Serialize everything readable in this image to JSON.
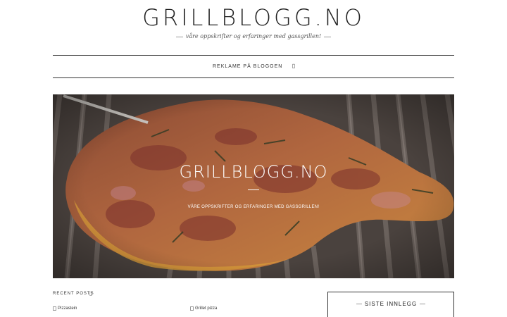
{
  "header": {
    "site_title": "GRILLBLOGG.NO",
    "tagline": "våre oppskrifter og erfaringer med gassgrillen!"
  },
  "nav": {
    "items": [
      {
        "label": "REKLAME PÅ BLOGGEN"
      }
    ],
    "search_icon": "search-icon"
  },
  "hero": {
    "title": "GRILLBLOGG.NO",
    "subtitle": "VÅRE OPPSKRIFTER OG ERFARINGER MED GASSGRILLEN!"
  },
  "recent_posts": {
    "label": "RECENT POSTS",
    "icon": "chevron-icon",
    "items": [
      {
        "alt": "Pizzastein"
      },
      {
        "alt": "Grillet pizza"
      }
    ]
  },
  "sidebar": {
    "widget_title": "SISTE INNLEGG"
  },
  "colors": {
    "text": "#222222",
    "border": "#333333",
    "hero_overlay_text": "#ffffff"
  }
}
